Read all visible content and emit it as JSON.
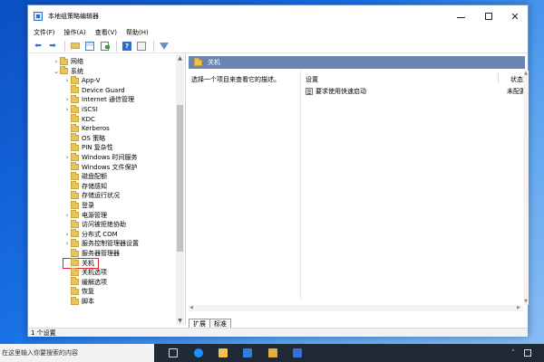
{
  "window": {
    "title": "本地组策略编辑器"
  },
  "menu": [
    "文件(F)",
    "操作(A)",
    "查看(V)",
    "帮助(H)"
  ],
  "toolbar": {
    "icons": [
      "back-icon",
      "forward-icon",
      "folder-up-icon",
      "show-tree-icon",
      "export-icon",
      "help-icon",
      "properties-icon",
      "filter-icon"
    ]
  },
  "tree": [
    {
      "label": "网络",
      "chev": "›",
      "indent": 0
    },
    {
      "label": "系统",
      "chev": "⌄",
      "indent": 0
    },
    {
      "label": "App-V",
      "chev": "›",
      "indent": 1
    },
    {
      "label": "Device Guard",
      "chev": "",
      "indent": 1
    },
    {
      "label": "Internet 通信管理",
      "chev": "›",
      "indent": 1
    },
    {
      "label": "iSCSI",
      "chev": "›",
      "indent": 1
    },
    {
      "label": "KDC",
      "chev": "",
      "indent": 1
    },
    {
      "label": "Kerberos",
      "chev": "",
      "indent": 1
    },
    {
      "label": "OS 策略",
      "chev": "",
      "indent": 1
    },
    {
      "label": "PIN 复杂性",
      "chev": "",
      "indent": 1
    },
    {
      "label": "Windows 时间服务",
      "chev": "›",
      "indent": 1
    },
    {
      "label": "Windows 文件保护",
      "chev": "",
      "indent": 1
    },
    {
      "label": "磁盘配额",
      "chev": "",
      "indent": 1
    },
    {
      "label": "存储感知",
      "chev": "",
      "indent": 1
    },
    {
      "label": "存储运行状况",
      "chev": "",
      "indent": 1
    },
    {
      "label": "登录",
      "chev": "",
      "indent": 1
    },
    {
      "label": "电源管理",
      "chev": "›",
      "indent": 1
    },
    {
      "label": "访问被拒绝协助",
      "chev": "",
      "indent": 1
    },
    {
      "label": "分布式 COM",
      "chev": "›",
      "indent": 1
    },
    {
      "label": "服务控制管理器设置",
      "chev": "›",
      "indent": 1
    },
    {
      "label": "服务器管理器",
      "chev": "",
      "indent": 1
    },
    {
      "label": "关机",
      "chev": "",
      "indent": 1,
      "selected": true
    },
    {
      "label": "关机选项",
      "chev": "",
      "indent": 1
    },
    {
      "label": "缓解选项",
      "chev": "",
      "indent": 1
    },
    {
      "label": "恢复",
      "chev": "",
      "indent": 1
    },
    {
      "label": "脚本",
      "chev": "",
      "indent": 1
    }
  ],
  "right": {
    "header": "关机",
    "description": "选择一个项目来查看它的描述。",
    "col_setting": "设置",
    "col_state": "状态",
    "rows": [
      {
        "setting": "要求使用快速启动",
        "state": "未配置"
      }
    ]
  },
  "tabs": [
    "扩展",
    "标准"
  ],
  "status": "1 个设置",
  "taskbar": {
    "search_placeholder": "在这里输入你要搜索的内容"
  },
  "colors": {
    "header": "#6b85b2",
    "selection_outline": "#e0262a",
    "folder": "#e8c55a",
    "taskbar": "#1f2a36"
  }
}
